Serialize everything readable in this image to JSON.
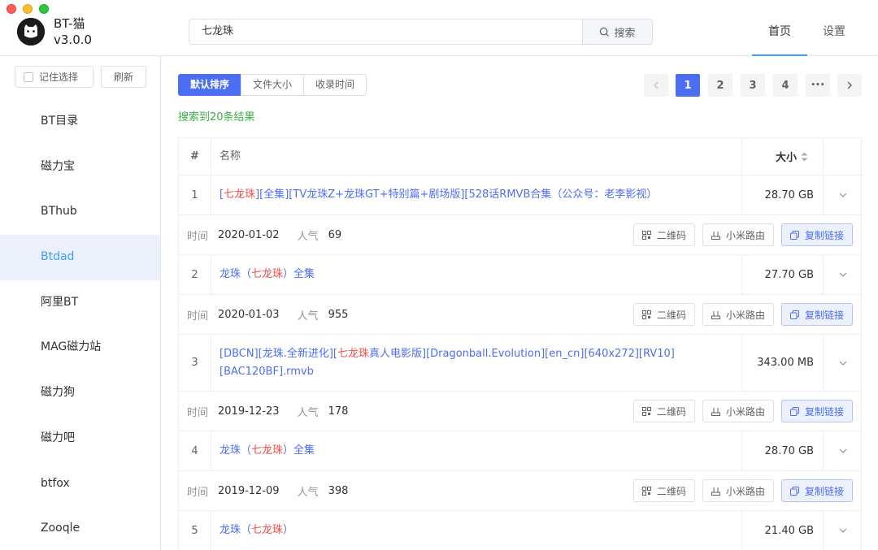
{
  "app": {
    "name": "BT-猫",
    "version": "v3.0.0"
  },
  "search": {
    "value": "七龙珠",
    "button_label": "搜索"
  },
  "nav": {
    "home": "首页",
    "settings": "设置"
  },
  "sidebar": {
    "remember_label": "记住选择",
    "refresh_label": "刷新",
    "items": [
      {
        "label": "BT目录"
      },
      {
        "label": "磁力宝"
      },
      {
        "label": "BThub"
      },
      {
        "label": "Btdad",
        "active": true
      },
      {
        "label": "阿里BT"
      },
      {
        "label": "MAG磁力站"
      },
      {
        "label": "磁力狗"
      },
      {
        "label": "磁力吧"
      },
      {
        "label": "btfox"
      },
      {
        "label": "Zooqle"
      }
    ]
  },
  "sort": {
    "default": "默认排序",
    "size": "文件大小",
    "time": "收录时间",
    "active": "default"
  },
  "pagination": {
    "pages": [
      "1",
      "2",
      "3",
      "4"
    ],
    "current": "1",
    "more": "•••"
  },
  "result_count": "搜索到20条结果",
  "table": {
    "headers": {
      "index": "#",
      "name": "名称",
      "size": "大小"
    },
    "meta_labels": {
      "time": "时间",
      "popularity": "人气"
    },
    "buttons": {
      "qrcode": "二维码",
      "router": "小米路由",
      "copy": "复制链接"
    },
    "rows": [
      {
        "index": "1",
        "name_parts": [
          {
            "text": "[",
            "hl": false
          },
          {
            "text": "七龙珠",
            "hl": true
          },
          {
            "text": "][全集][TV龙珠Z+龙珠GT+特别篇+剧场版][528话RMVB合集（公众号：老李影视）",
            "hl": false
          }
        ],
        "size": "28.70 GB",
        "time": "2020-01-02",
        "popularity": "69"
      },
      {
        "index": "2",
        "name_parts": [
          {
            "text": "龙珠（",
            "hl": false
          },
          {
            "text": "七龙珠",
            "hl": true
          },
          {
            "text": "）全集",
            "hl": false
          }
        ],
        "size": "27.70 GB",
        "time": "2020-01-03",
        "popularity": "955"
      },
      {
        "index": "3",
        "name_parts": [
          {
            "text": "[DBCN][龙珠.全新进化][",
            "hl": false
          },
          {
            "text": "七龙珠",
            "hl": true
          },
          {
            "text": "真人电影版][Dragonball.Evolution][en_cn][640x272][RV10][BAC120BF].rmvb",
            "hl": false
          }
        ],
        "size": "343.00 MB",
        "time": "2019-12-23",
        "popularity": "178"
      },
      {
        "index": "4",
        "name_parts": [
          {
            "text": "龙珠（",
            "hl": false
          },
          {
            "text": "七龙珠",
            "hl": true
          },
          {
            "text": "）全集",
            "hl": false
          }
        ],
        "size": "28.70 GB",
        "time": "2019-12-09",
        "popularity": "398"
      },
      {
        "index": "5",
        "name_parts": [
          {
            "text": "龙珠（",
            "hl": false
          },
          {
            "text": "七龙珠",
            "hl": true
          },
          {
            "text": "）",
            "hl": false
          }
        ],
        "size": "21.40 GB"
      }
    ]
  },
  "colors": {
    "accent": "#4c6ef5",
    "highlight": "#f04d4d",
    "success": "#3cb043",
    "active_bg": "#ecf0fb"
  },
  "icons": [
    "search-icon",
    "qrcode-icon",
    "router-icon",
    "copy-icon",
    "chevron-down-icon",
    "chevron-left-icon",
    "chevron-right-icon",
    "sort-caret-icon",
    "cat-logo-icon"
  ]
}
